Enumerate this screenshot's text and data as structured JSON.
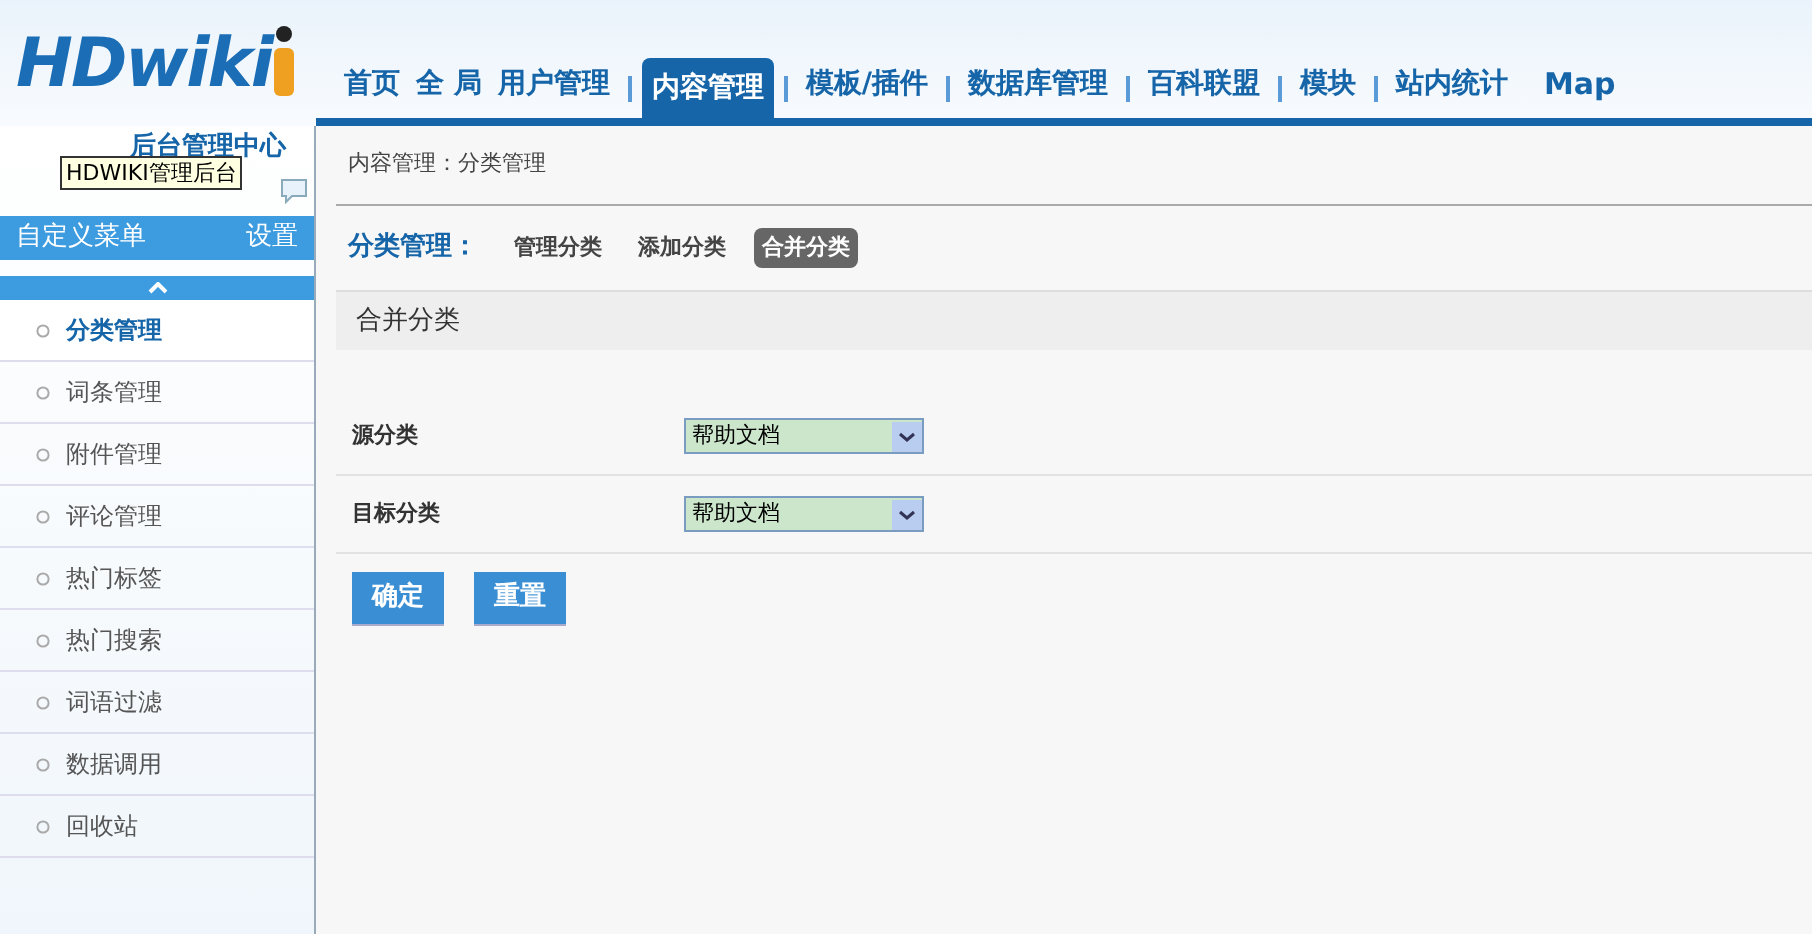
{
  "logo": {
    "wordmark": "HDwiki",
    "subtitle": "后台管理中心",
    "tooltip": "HDWIKI管理后台"
  },
  "nav": [
    {
      "label": "首页",
      "selected": false
    },
    {
      "label": "全 局",
      "selected": false
    },
    {
      "label": "用户管理",
      "selected": false
    },
    {
      "label": "内容管理",
      "selected": true
    },
    {
      "label": "模板/插件",
      "selected": false
    },
    {
      "label": "数据库管理",
      "selected": false
    },
    {
      "label": "百科联盟",
      "selected": false
    },
    {
      "label": "模块",
      "selected": false
    },
    {
      "label": "站内统计",
      "selected": false
    },
    {
      "label": "Map",
      "selected": false
    }
  ],
  "sidebar": {
    "title": "自定义菜单",
    "settings": "设置",
    "items": [
      {
        "label": "分类管理",
        "selected": true
      },
      {
        "label": "词条管理",
        "selected": false
      },
      {
        "label": "附件管理",
        "selected": false
      },
      {
        "label": "评论管理",
        "selected": false
      },
      {
        "label": "热门标签",
        "selected": false
      },
      {
        "label": "热门搜索",
        "selected": false
      },
      {
        "label": "词语过滤",
        "selected": false
      },
      {
        "label": "数据调用",
        "selected": false
      },
      {
        "label": "回收站",
        "selected": false
      }
    ]
  },
  "breadcrumb": "内容管理：分类管理",
  "subnav": {
    "title": "分类管理：",
    "tabs": [
      {
        "label": "管理分类",
        "selected": false
      },
      {
        "label": "添加分类",
        "selected": false
      },
      {
        "label": "合并分类",
        "selected": true
      }
    ]
  },
  "section_title": "合并分类",
  "fields": [
    {
      "label": "源分类",
      "value": "帮助文档"
    },
    {
      "label": "目标分类",
      "value": "帮助文档"
    }
  ],
  "buttons": [
    "确定",
    "重置"
  ]
}
